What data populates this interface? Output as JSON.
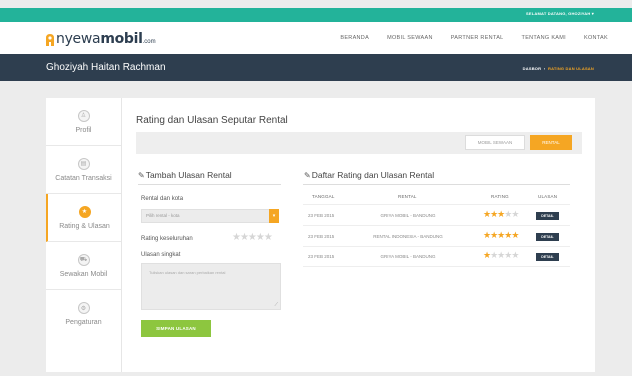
{
  "topbar": {
    "greeting": "SELAMAT DATANG, GHOZIYAH ▾"
  },
  "brand": {
    "name_light": "nyewa",
    "name_bold": "mobil",
    "suffix": ".com"
  },
  "nav": {
    "items": [
      "BERANDA",
      "MOBIL SEWAAN",
      "PARTNER RENTAL",
      "TENTANG KAMI",
      "KONTAK"
    ]
  },
  "header": {
    "user_name": "Ghoziyah Haitan Rachman",
    "breadcrumb": {
      "home": "DASBOR",
      "current": "RATING DAN ULASAN"
    }
  },
  "sidebar": {
    "items": [
      {
        "label": "Profil",
        "icon": "user-icon",
        "glyph": "♙",
        "active": false
      },
      {
        "label": "Catatan Transaksi",
        "icon": "receipt-icon",
        "glyph": "▤",
        "active": false
      },
      {
        "label": "Rating & Ulasan",
        "icon": "thumbs-up-icon",
        "glyph": "★",
        "active": true
      },
      {
        "label": "Sewakan Mobil",
        "icon": "car-icon",
        "glyph": "⛟",
        "active": false
      },
      {
        "label": "Pengaturan",
        "icon": "gear-icon",
        "glyph": "⚙",
        "active": false
      }
    ]
  },
  "main": {
    "title": "Rating dan Ulasan Seputar Rental",
    "tabs": {
      "mobil": "MOBIL SEWAAN",
      "rental": "RENTAL"
    }
  },
  "form": {
    "title": "Tambah Ulasan Rental",
    "rental_label": "Rental dan kota",
    "select_placeholder": "Pilih rental - kota",
    "overall_label": "Rating keseluruhan",
    "review_label": "Ulasan singkat",
    "review_placeholder": "Tuliskan ulasan dan saran perbaikan rental",
    "save_label": "SIMPAN ULASAN"
  },
  "list": {
    "title": "Daftar Rating dan Ulasan Rental",
    "columns": [
      "TANGGAL",
      "RENTAL",
      "RATING",
      "ULASAN"
    ],
    "rows": [
      {
        "date": "23 FEB 2015",
        "rental": "GRIYA MOBIL - BANDUNG",
        "rating": 3,
        "action": "DETAIL"
      },
      {
        "date": "23 FEB 2015",
        "rental": "RENTAL INDONESIA - BANDUNG",
        "rating": 5,
        "action": "DETAIL"
      },
      {
        "date": "23 FEB 2015",
        "rental": "GRIYA MOBIL - BANDUNG",
        "rating": 1,
        "action": "DETAIL"
      }
    ]
  },
  "colors": {
    "accent": "#f5a623",
    "primary_dark": "#2e3e4f",
    "topbar": "#23b39a",
    "save": "#8dc63f"
  }
}
